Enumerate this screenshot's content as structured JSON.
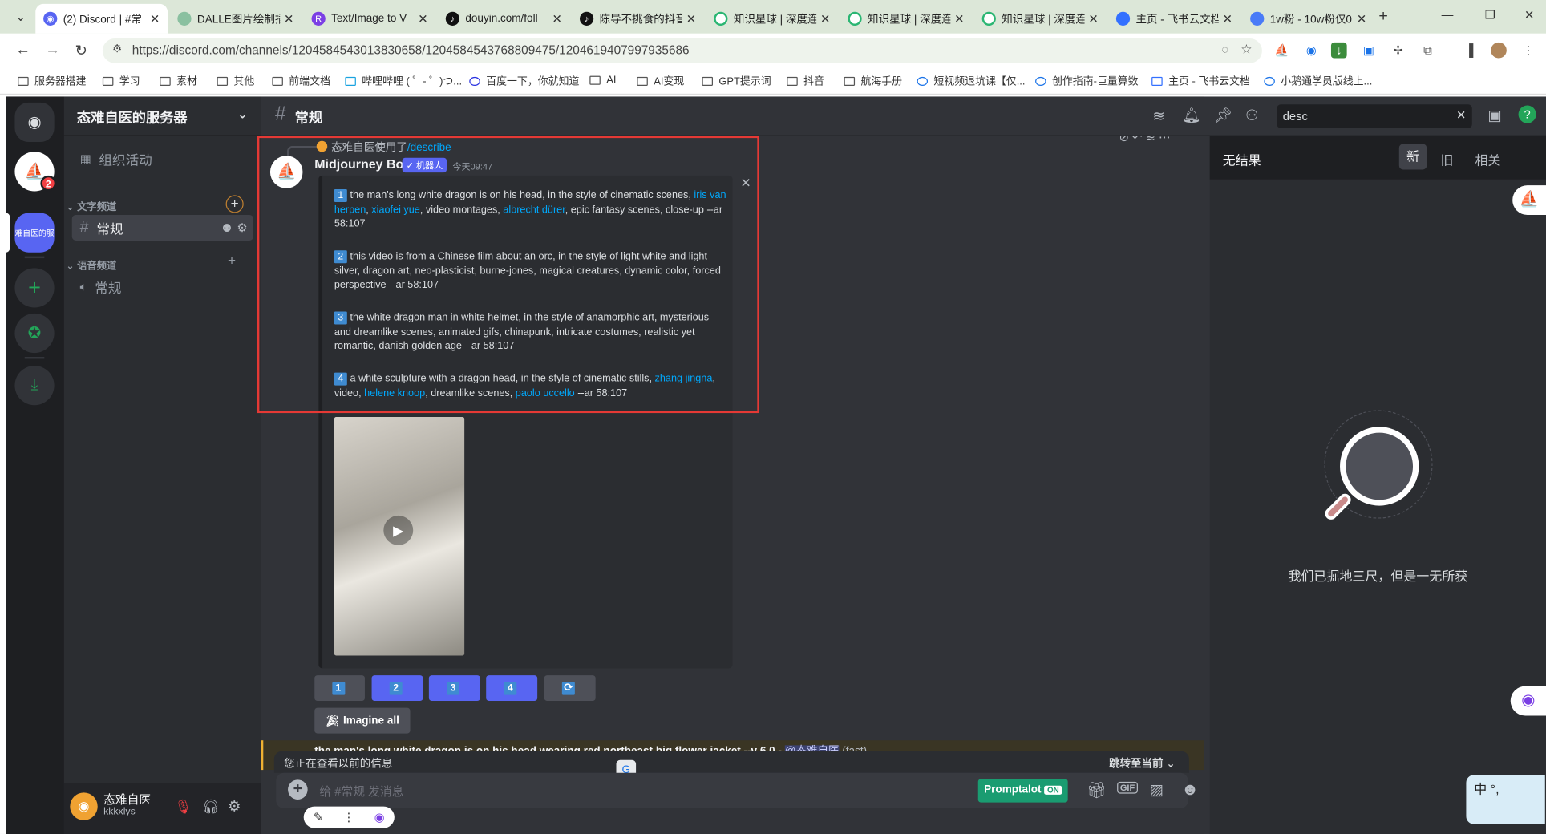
{
  "browser": {
    "tabs": [
      {
        "title": "(2) Discord | #常",
        "active": true
      },
      {
        "title": "DALLE图片绘制插"
      },
      {
        "title": "Text/Image to V"
      },
      {
        "title": "douyin.com/foll"
      },
      {
        "title": "陈导不挑食的抖音"
      },
      {
        "title": "知识星球 | 深度连"
      },
      {
        "title": "知识星球 | 深度连"
      },
      {
        "title": "知识星球 | 深度连"
      },
      {
        "title": "主页 - 飞书云文档"
      },
      {
        "title": "1w粉 - 10w粉仅0"
      }
    ],
    "url": "https://discord.com/channels/1204584543013830658/1204584543768809475/1204619407997935686",
    "bookmarks": [
      "服务器搭建",
      "学习",
      "素材",
      "其他",
      "前端文档",
      "哔哩哔哩 ( ゜- ゜)つ...",
      "百度一下，你就知道",
      "AI",
      "AI变现",
      "GPT提示词",
      "抖音",
      "航海手册",
      "短视频退坑课【仅...",
      "创作指南-巨量算数",
      "主页 - 飞书云文档",
      "小鹅通学员版线上..."
    ]
  },
  "guilds": {
    "server_badge": "2",
    "active_server_label": "态难自医的服务"
  },
  "sidebar": {
    "server_name": "态难自医的服务器",
    "events_label": "组织活动",
    "text_category": "文字频道",
    "text_channel": "常规",
    "voice_category": "语音频道",
    "voice_channel": "常规"
  },
  "user": {
    "name": "态难自医",
    "tag": "kkkxlys"
  },
  "header": {
    "channel": "常规",
    "search_value": "desc"
  },
  "message": {
    "reply_user": "态难自医使用了",
    "reply_command": "/describe",
    "author": "Midjourney Bot",
    "bot_tag": "✓ 机器人",
    "time": "今天09:47",
    "prompts": [
      {
        "n": "1",
        "parts": [
          [
            "the man's long white dragon is on his head, in the style of cinematic scenes, ",
            false
          ],
          [
            "iris van herpen",
            true
          ],
          [
            ", ",
            false
          ],
          [
            "xiaofei yue",
            true
          ],
          [
            ", video montages, ",
            false
          ],
          [
            "albrecht dürer",
            true
          ],
          [
            ", epic fantasy scenes, close-up --ar 58:107",
            false
          ]
        ]
      },
      {
        "n": "2",
        "parts": [
          [
            "this video is from a Chinese film about an orc, in the style of light white and light silver, dragon art, neo-plasticist, burne-jones, magical creatures, dynamic color, forced perspective --ar 58:107",
            false
          ]
        ]
      },
      {
        "n": "3",
        "parts": [
          [
            "the white dragon man in white helmet, in the style of anamorphic art, mysterious and dreamlike scenes, animated gifs, chinapunk, intricate costumes, realistic yet romantic, danish golden age --ar 58:107",
            false
          ]
        ]
      },
      {
        "n": "4",
        "parts": [
          [
            "a white sculpture with a dragon head, in the style of cinematic stills, ",
            false
          ],
          [
            "zhang jingna",
            true
          ],
          [
            ", video, ",
            false
          ],
          [
            "helene knoop",
            true
          ],
          [
            ", dreamlike scenes, ",
            false
          ],
          [
            "paolo uccello",
            true
          ],
          [
            " --ar 58:107",
            false
          ]
        ]
      }
    ],
    "buttons": [
      "1",
      "2",
      "3",
      "4"
    ],
    "imagine_all": "Imagine all",
    "next_message": "the man's long white dragon is on his head wearing red northeast big flower jacket --v 6.0 -",
    "next_mention": "@态难自医",
    "next_speed": "(fast)"
  },
  "older_bar": {
    "text": "您正在查看以前的信息",
    "jump": "跳转至当前"
  },
  "composer": {
    "placeholder": "给 #常规 发消息",
    "promptalot": "Promptalot",
    "on": "ON"
  },
  "search_panel": {
    "title": "无结果",
    "tabs": [
      "新",
      "旧",
      "相关"
    ],
    "empty_text": "我们已掘地三尺，但是一无所获"
  }
}
